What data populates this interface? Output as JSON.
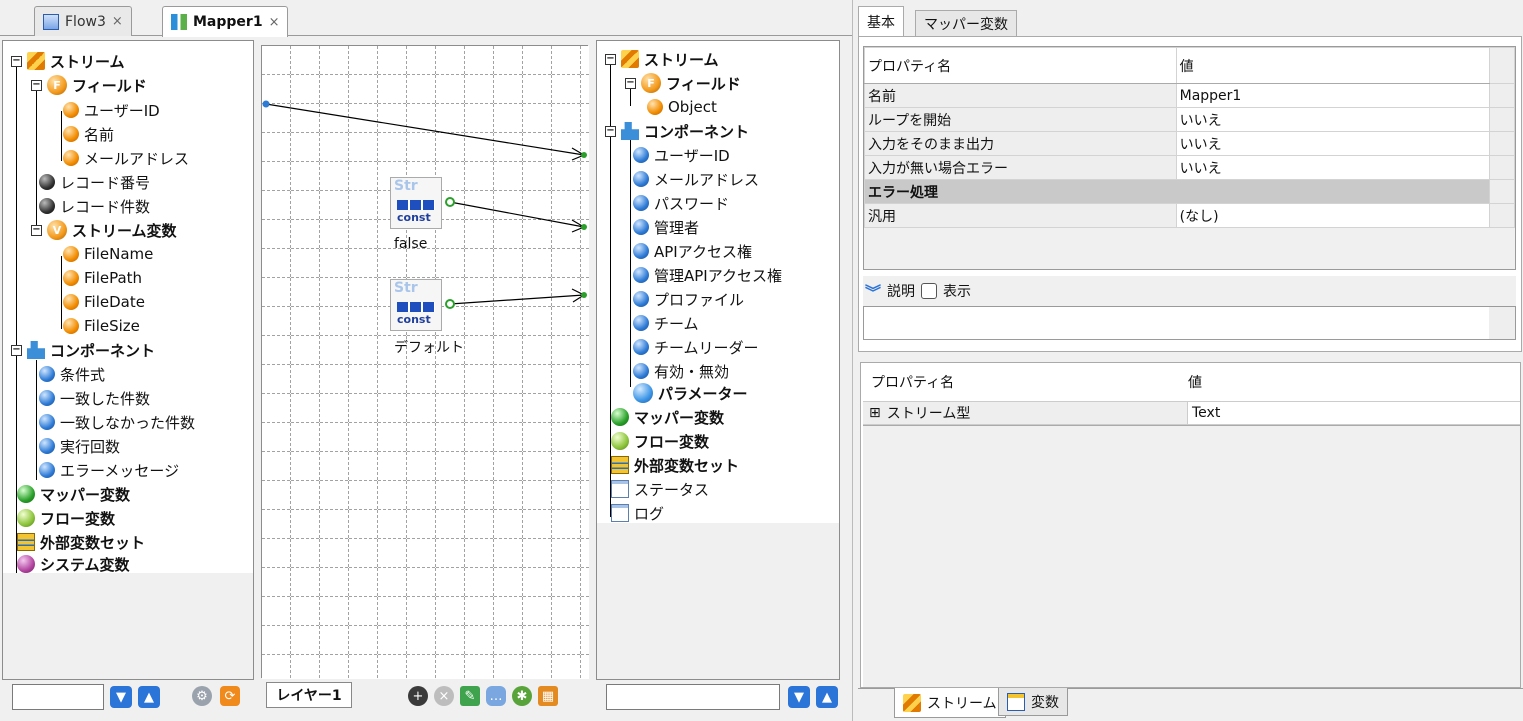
{
  "editor_tabs": [
    {
      "label": "Flow3",
      "active": false
    },
    {
      "label": "Mapper1",
      "active": true
    }
  ],
  "close_glyph": "×",
  "left_tree": {
    "stream": "ストリーム",
    "field": "フィールド",
    "fields": [
      "ユーザーID",
      "名前",
      "メールアドレス"
    ],
    "record_no": "レコード番号",
    "record_count": "レコード件数",
    "stream_vars": "ストリーム変数",
    "stream_var_items": [
      "FileName",
      "FilePath",
      "FileDate",
      "FileSize"
    ],
    "component": "コンポーネント",
    "component_items": [
      "条件式",
      "一致した件数",
      "一致しなかった件数",
      "実行回数",
      "エラーメッセージ"
    ],
    "mapper_vars": "マッパー変数",
    "flow_vars": "フロー変数",
    "ext_var_set": "外部変数セット",
    "system_vars": "システム変数"
  },
  "canvas": {
    "const_blocks": [
      {
        "str": "Str",
        "const": "const",
        "caption": "false"
      },
      {
        "str": "Str",
        "const": "const",
        "caption": "デフォルト"
      }
    ],
    "layer_tab": "レイヤー1"
  },
  "right_tree": {
    "stream": "ストリーム",
    "field": "フィールド",
    "fields": [
      "Object"
    ],
    "component": "コンポーネント",
    "component_items": [
      "ユーザーID",
      "メールアドレス",
      "パスワード",
      "管理者",
      "APIアクセス権",
      "管理APIアクセス権",
      "プロファイル",
      "チーム",
      "チームリーダー",
      "有効・無効"
    ],
    "parameter": "パラメーター",
    "mapper_vars": "マッパー変数",
    "flow_vars": "フロー変数",
    "ext_var_set": "外部変数セット",
    "status": "ステータス",
    "log": "ログ"
  },
  "property_panel": {
    "tabs": [
      "基本",
      "マッパー変数"
    ],
    "header": {
      "name": "プロパティ名",
      "value": "値"
    },
    "rows": [
      {
        "name": "名前",
        "value": "Mapper1"
      },
      {
        "name": "ループを開始",
        "value": "いいえ"
      },
      {
        "name": "入力をそのまま出力",
        "value": "いいえ"
      },
      {
        "name": "入力が無い場合エラー",
        "value": "いいえ"
      }
    ],
    "section": "エラー処理",
    "section_rows": [
      {
        "name": "汎用",
        "value": "(なし)"
      }
    ],
    "description_label": "説明",
    "show_label": "表示"
  },
  "stream_panel": {
    "header": {
      "name": "プロパティ名",
      "value": "値"
    },
    "expander": "⊞",
    "rows": [
      {
        "name": "ストリーム型",
        "value": "Text"
      }
    ],
    "bottom_tabs": [
      "ストリーム",
      "変数"
    ]
  }
}
